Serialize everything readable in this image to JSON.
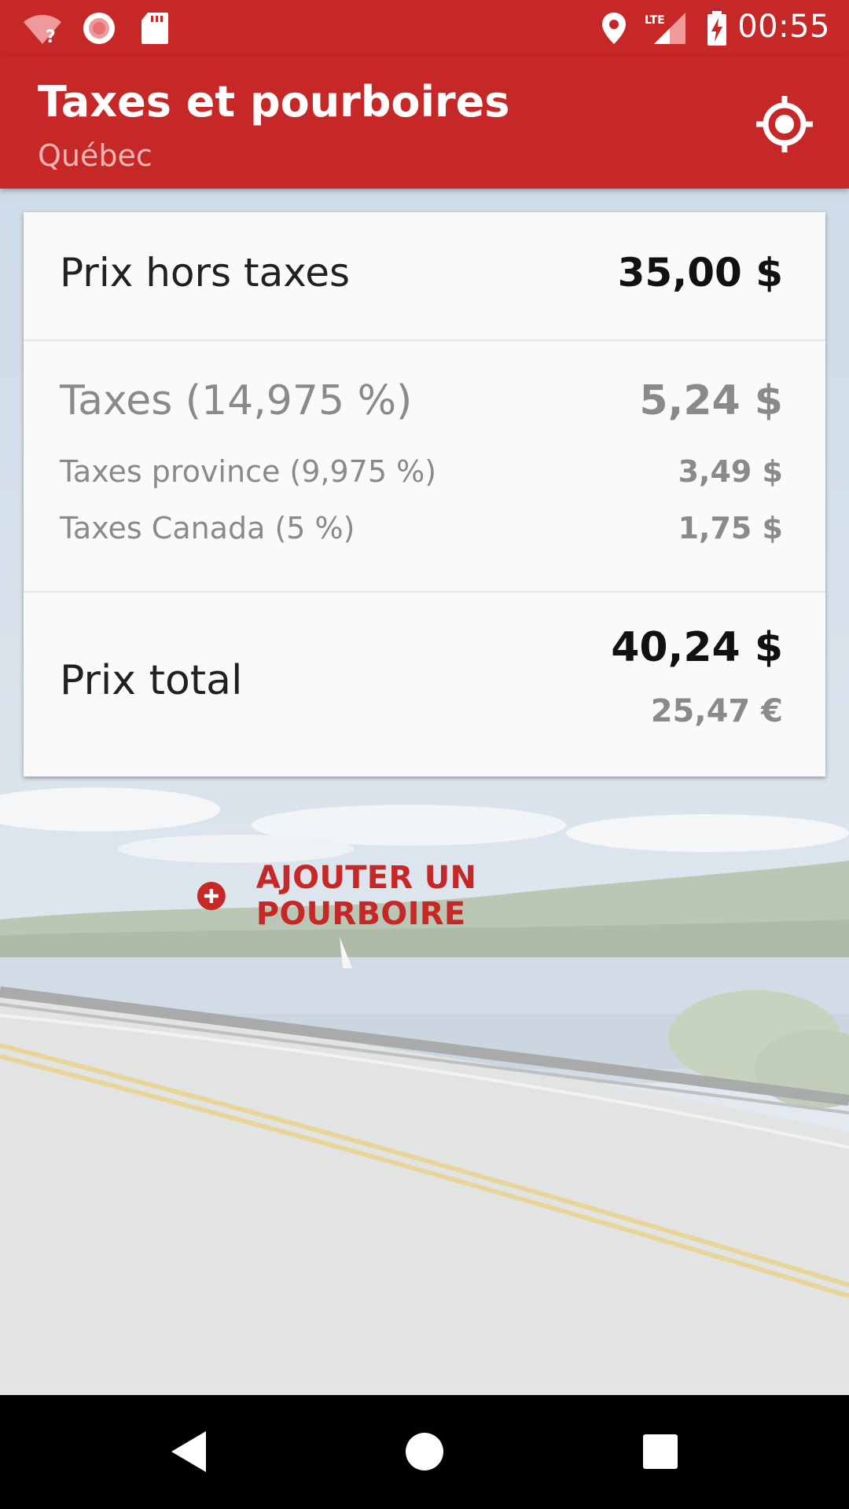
{
  "status_bar": {
    "time": "00:55",
    "icons": [
      "wifi-unknown-icon",
      "record-icon",
      "sd-card-icon",
      "location-icon",
      "lte-signal-icon",
      "battery-charging-icon"
    ],
    "network_label": "LTE"
  },
  "app_bar": {
    "title": "Taxes et pourboires",
    "subtitle": "Québec",
    "action_icon": "my-location-icon"
  },
  "summary": {
    "subtotal": {
      "label": "Prix hors taxes",
      "value": "35,00  $"
    },
    "taxes": {
      "label": "Taxes (14,975 %)",
      "value": "5,24  $",
      "province": {
        "label": "Taxes province (9,975 %)",
        "value": "3,49  $"
      },
      "canada": {
        "label": "Taxes Canada (5 %)",
        "value": "1,75  $"
      }
    },
    "total": {
      "label": "Prix total",
      "value": "40,24  $",
      "value_eur": "25,47  €"
    }
  },
  "actions": {
    "add_tip_label": "AJOUTER UN POURBOIRE",
    "add_tip_icon": "add-circle-icon"
  },
  "nav_bar": {
    "icons": [
      "back-icon",
      "home-icon",
      "recents-icon"
    ]
  },
  "colors": {
    "primary": "#c62828",
    "card": "#fafafa",
    "muted_text": "#8a8a8a"
  }
}
